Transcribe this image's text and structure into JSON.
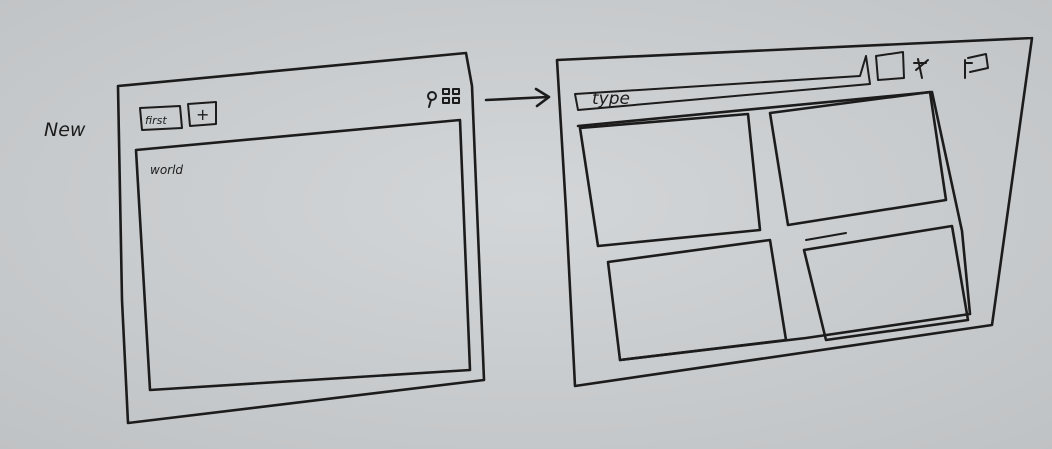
{
  "sketch": {
    "left_label": "New",
    "left_tab_label": "first",
    "left_new_tab_symbol": "+",
    "left_content_label": "world",
    "right_field_text": "type",
    "colors": {
      "paper": "#c9ccce",
      "ink": "#1c1c1c"
    },
    "icons": {
      "left_toolbar": [
        "search-icon",
        "grid-icon"
      ],
      "right_toolbar": [
        "square-icon",
        "star-icon",
        "flag-icon"
      ],
      "connector": "arrow-right-icon"
    }
  }
}
